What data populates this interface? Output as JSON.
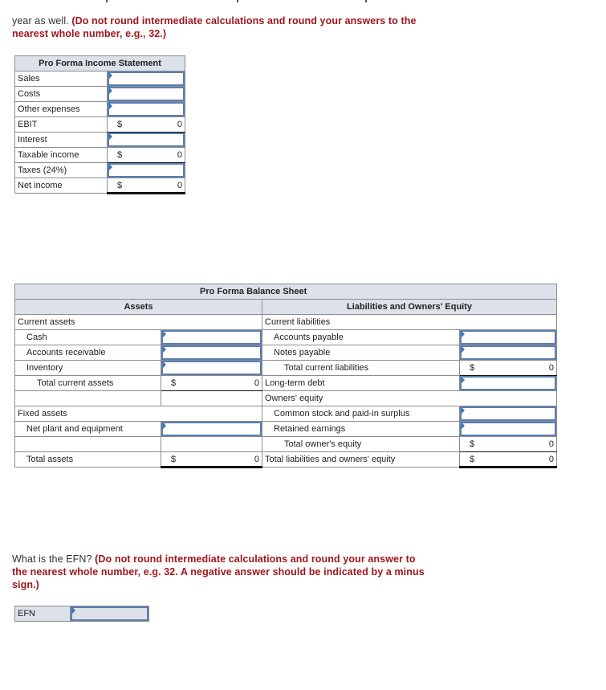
{
  "instructions_top": {
    "lead": "year as well.",
    "emphasis_line1": "(Do not round intermediate calculations and round your answers to the",
    "emphasis_line2": "nearest whole number, e.g., 32.)"
  },
  "income_statement": {
    "title": "Pro Forma Income Statement",
    "rows": [
      {
        "label": "Sales",
        "type": "input",
        "value": ""
      },
      {
        "label": "Costs",
        "type": "input",
        "value": ""
      },
      {
        "label": "Other expenses",
        "type": "input",
        "value": ""
      },
      {
        "label": "EBIT",
        "type": "calc",
        "currency": "$",
        "value": "0"
      },
      {
        "label": "Interest",
        "type": "input",
        "value": ""
      },
      {
        "label": "Taxable income",
        "type": "calc",
        "currency": "$",
        "value": "0"
      },
      {
        "label": "Taxes (24%)",
        "type": "input",
        "value": ""
      },
      {
        "label": "Net income",
        "type": "calc",
        "currency": "$",
        "value": "0"
      }
    ]
  },
  "balance_sheet": {
    "title": "Pro Forma Balance Sheet",
    "assets_header": "Assets",
    "liabilities_header": "Liabilities and Owners' Equity",
    "assets": {
      "current_assets": "Current assets",
      "cash": "Cash",
      "accounts_receivable": "Accounts receivable",
      "inventory": "Inventory",
      "total_current_assets": "Total current assets",
      "total_current_assets_currency": "$",
      "total_current_assets_value": "0",
      "fixed_assets": "Fixed assets",
      "net_plant": "Net plant and equipment",
      "total_assets": "Total assets",
      "total_assets_currency": "$",
      "total_assets_value": "0"
    },
    "liabilities": {
      "current_liabilities": "Current liabilities",
      "accounts_payable": "Accounts payable",
      "notes_payable": "Notes payable",
      "total_current_liabilities": "Total current liabilities",
      "total_current_liabilities_currency": "$",
      "total_current_liabilities_value": "0",
      "long_term_debt": "Long-term debt",
      "owners_equity": "Owners' equity",
      "common_stock": "Common stock and paid-in surplus",
      "retained_earnings": "Retained earnings",
      "total_owners_equity": "Total owner's equity",
      "total_owners_equity_currency": "$",
      "total_owners_equity_value": "0",
      "total_liab_equity": "Total liabilities and owners' equity",
      "total_liab_equity_currency": "$",
      "total_liab_equity_value": "0"
    }
  },
  "efn_question": {
    "lead": "What is the EFN?",
    "emphasis_line1": "(Do not round intermediate calculations and round your answer to",
    "emphasis_line2": "the nearest whole number, e.g. 32. A negative answer should be indicated by a minus",
    "emphasis_line3": "sign.)",
    "label": "EFN",
    "value": ""
  }
}
